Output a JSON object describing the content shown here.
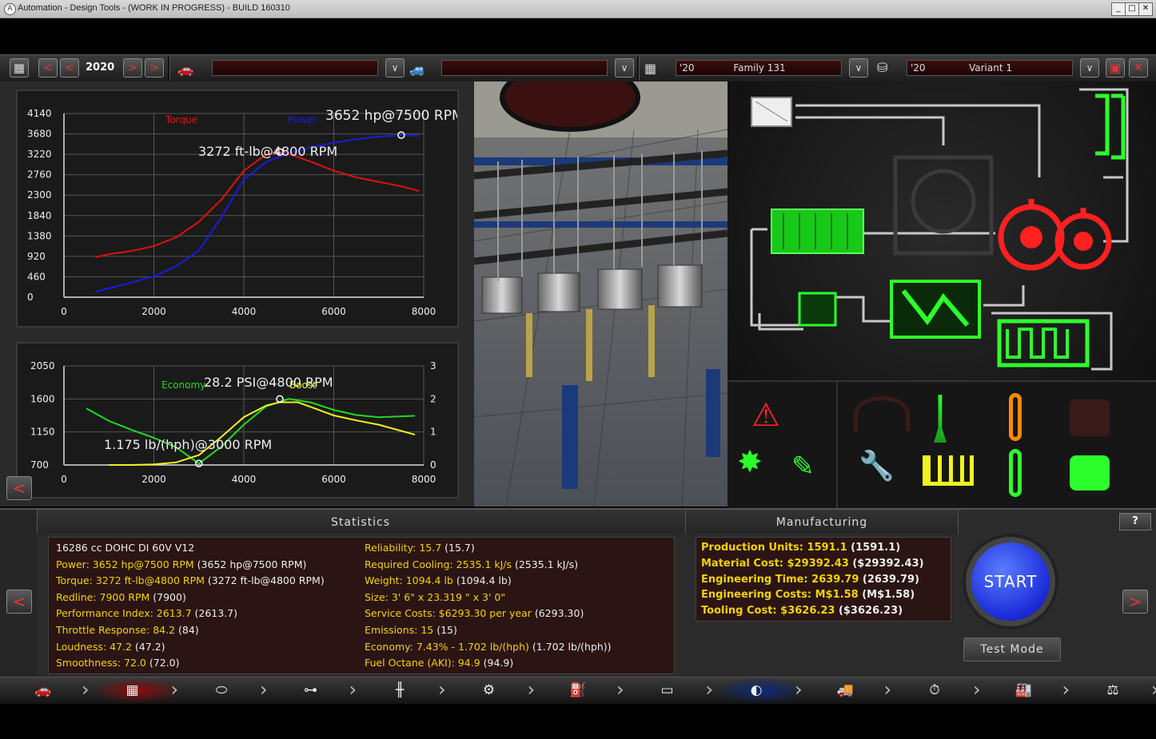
{
  "window": {
    "title": "Automation - Design Tools - (WORK IN PROGRESS) - BUILD 160310",
    "min": "_",
    "max": "□",
    "close": "✕"
  },
  "topbar": {
    "year": "2020",
    "prev": "<",
    "next": ">",
    "car_model_value": "",
    "car_trim_value": "",
    "family_year": "'20",
    "family_name": "Family 131",
    "variant_year": "'20",
    "variant_name": "Variant 1",
    "dropdown": "∨",
    "save_icon": "floppy-icon",
    "close": "✕"
  },
  "torque_chart": {
    "chart_data": {
      "type": "line",
      "xlim": [
        0,
        8000
      ],
      "ylim": [
        0,
        4140
      ],
      "x_ticks": [
        "0",
        "2000",
        "4000",
        "6000",
        "8000"
      ],
      "y_ticks": [
        "0",
        "460",
        "920",
        "1380",
        "1840",
        "2300",
        "2760",
        "3220",
        "3680",
        "4140"
      ],
      "grid": true,
      "legend_position": "top",
      "series": [
        {
          "name": "Torque",
          "color": "#e01010",
          "x": [
            700,
            1000,
            1500,
            2000,
            2500,
            3000,
            3500,
            4000,
            4500,
            4800,
            5000,
            5500,
            6000,
            6500,
            7000,
            7500,
            7900
          ],
          "y": [
            900,
            970,
            1040,
            1150,
            1350,
            1700,
            2200,
            2850,
            3220,
            3272,
            3230,
            3050,
            2850,
            2700,
            2600,
            2500,
            2390
          ]
        },
        {
          "name": "Power",
          "color": "#1a1ae6",
          "x": [
            700,
            1000,
            1500,
            2000,
            2500,
            3000,
            3500,
            4000,
            4500,
            5000,
            5500,
            6000,
            6500,
            7000,
            7500,
            7900
          ],
          "y": [
            120,
            200,
            330,
            470,
            700,
            1050,
            1800,
            2650,
            3050,
            3250,
            3380,
            3480,
            3560,
            3620,
            3652,
            3640
          ]
        }
      ],
      "annotations": [
        {
          "text": "3652 hp@7500 RPM",
          "x": 7500,
          "y": 3652
        },
        {
          "text": "3272 ft-lb@4800 RPM",
          "x": 4800,
          "y": 3272
        }
      ]
    }
  },
  "boost_chart": {
    "chart_data": {
      "type": "line",
      "xlim": [
        0,
        8000
      ],
      "ylim_left": [
        700,
        2050
      ],
      "ylim_right": [
        0,
        3
      ],
      "x_ticks": [
        "0",
        "2000",
        "4000",
        "6000",
        "8000"
      ],
      "y_ticks_left": [
        "700",
        "1150",
        "1600",
        "2050"
      ],
      "y_ticks_right": [
        "0",
        "1",
        "2",
        "3"
      ],
      "grid": true,
      "legend_position": "top",
      "series": [
        {
          "name": "Economy",
          "color": "#1edc1e",
          "axis": "left",
          "x": [
            500,
            1000,
            1500,
            2000,
            2500,
            3000,
            3500,
            4000,
            4500,
            5000,
            5500,
            6000,
            6500,
            7000,
            7800
          ],
          "y": [
            1470,
            1300,
            1180,
            1070,
            940,
            720,
            950,
            1250,
            1500,
            1600,
            1550,
            1450,
            1380,
            1350,
            1370
          ]
        },
        {
          "name": "Boost",
          "color": "#f2f21e",
          "axis": "right",
          "x": [
            1000,
            1500,
            2000,
            2500,
            3000,
            3500,
            4000,
            4500,
            4800,
            5200,
            5600,
            6000,
            6500,
            7000,
            7800
          ],
          "y": [
            0,
            0,
            0.02,
            0.08,
            0.3,
            0.85,
            1.45,
            1.8,
            1.9,
            1.9,
            1.7,
            1.5,
            1.35,
            1.22,
            0.92
          ]
        }
      ],
      "annotations": [
        {
          "text": "28.2 PSI@4800 RPM",
          "x": 4800,
          "y": 1600
        },
        {
          "text": "1.175 lb/(hph)@3000 RPM",
          "x": 3000,
          "y": 720
        }
      ]
    }
  },
  "back_button": "<",
  "statistics": {
    "title": "Statistics",
    "left": [
      {
        "label": "",
        "value": "16286 cc DOHC DI 60V V12",
        "extra": ""
      },
      {
        "label": "Power:",
        "value": "3652 hp@7500 RPM",
        "extra": "(3652 hp@7500 RPM)"
      },
      {
        "label": "Torque:",
        "value": "3272 ft-lb@4800 RPM",
        "extra": "(3272 ft-lb@4800 RPM)"
      },
      {
        "label": "Redline:",
        "value": "7900 RPM",
        "extra": "(7900)"
      },
      {
        "label": "Performance Index:",
        "value": "2613.7",
        "extra": "(2613.7)"
      },
      {
        "label": "Throttle Response:",
        "value": "84.2",
        "extra": "(84)"
      },
      {
        "label": "Loudness:",
        "value": "47.2",
        "extra": "(47.2)"
      },
      {
        "label": "Smoothness:",
        "value": "72.0",
        "extra": "(72.0)"
      }
    ],
    "right": [
      {
        "label": "Reliability:",
        "value": "15.7",
        "extra": "(15.7)"
      },
      {
        "label": "Required Cooling:",
        "value": "2535.1 kJ/s",
        "extra": "(2535.1 kJ/s)"
      },
      {
        "label": "Weight:",
        "value": "1094.4 lb",
        "extra": "(1094.4 lb)"
      },
      {
        "label": "Size:",
        "value": "3' 6\" x 23.319 \" x 3' 0\"",
        "extra": ""
      },
      {
        "label": "Service Costs:",
        "value": "$6293.30 per year",
        "extra": "(6293.30)"
      },
      {
        "label": "Emissions:",
        "value": "15",
        "extra": "(15)"
      },
      {
        "label": "Economy:",
        "value": "7.43% - 1.702 lb/(hph)",
        "extra": "(1.702 lb/(hph))"
      },
      {
        "label": "Fuel Octane (AKI):",
        "value": "94.9",
        "extra": "(94.9)"
      }
    ]
  },
  "manufacturing": {
    "title": "Manufacturing",
    "help": "?",
    "rows": [
      {
        "label": "Production Units:",
        "value": "1591.1",
        "extra": "(1591.1)"
      },
      {
        "label": "Material Cost:",
        "value": "$29392.43",
        "extra": "($29392.43)"
      },
      {
        "label": "Engineering Time:",
        "value": "2639.79",
        "extra": "(2639.79)"
      },
      {
        "label": "Engineering Costs:",
        "value": "M$1.58",
        "extra": "(M$1.58)"
      },
      {
        "label": "Tooling Cost:",
        "value": "$3626.23",
        "extra": "($3626.23)"
      }
    ],
    "start_label": "START",
    "test_mode_label": "Test Mode"
  },
  "nav": {
    "left": "<",
    "right": ">",
    "tabs": [
      {
        "icon": "car-icon",
        "glyph": "🚗"
      },
      {
        "icon": "engine-block-icon",
        "glyph": "▦"
      },
      {
        "icon": "head-icon",
        "glyph": "⬭"
      },
      {
        "icon": "crank-icon",
        "glyph": "⊶"
      },
      {
        "icon": "valvetrain-icon",
        "glyph": "╫"
      },
      {
        "icon": "turbo-icon",
        "glyph": "⚙"
      },
      {
        "icon": "fuel-icon",
        "glyph": "⛽"
      },
      {
        "icon": "exhaust-icon",
        "glyph": "▭"
      },
      {
        "icon": "tune-icon",
        "glyph": "◐"
      },
      {
        "icon": "truck-icon",
        "glyph": "🚚"
      },
      {
        "icon": "test-icon",
        "glyph": "⏱"
      },
      {
        "icon": "factory-icon",
        "glyph": "🏭"
      },
      {
        "icon": "market-icon",
        "glyph": "⚖"
      }
    ]
  }
}
